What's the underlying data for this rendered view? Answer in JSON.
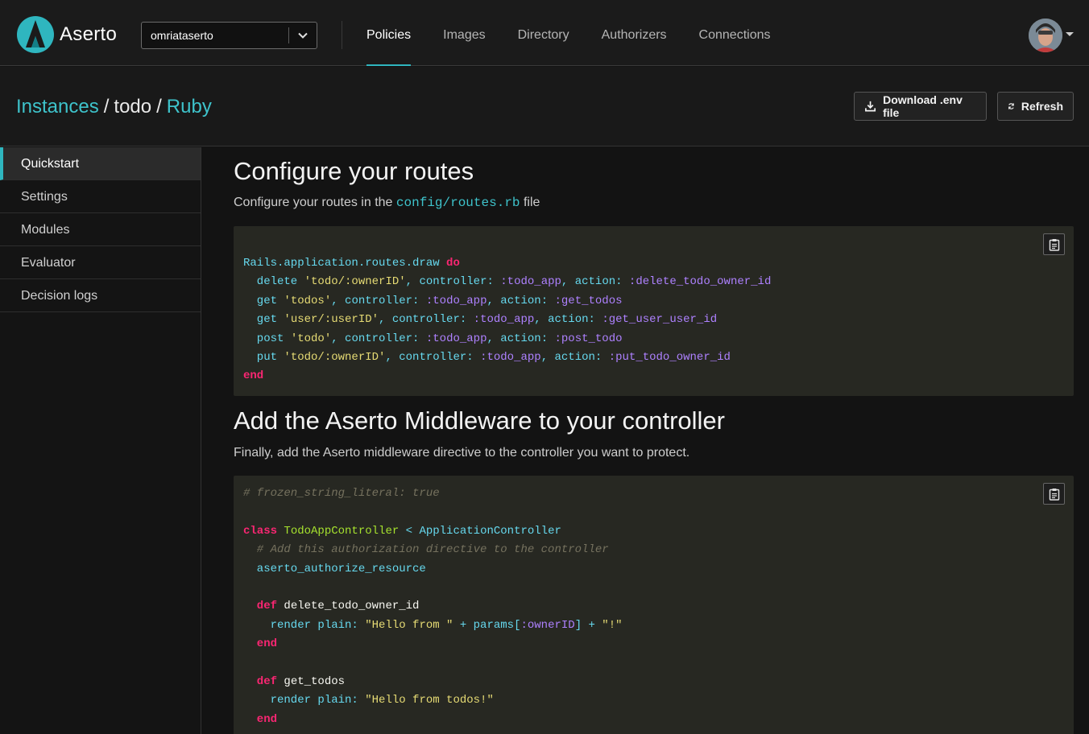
{
  "app": {
    "logo_text": "Aserto",
    "tenant": "omriataserto",
    "nav": [
      "Policies",
      "Images",
      "Directory",
      "Authorizers",
      "Connections"
    ],
    "active_nav": "Policies"
  },
  "header": {
    "crumbs": [
      "Instances",
      "todo",
      "Ruby"
    ],
    "download_label": "Download .env file",
    "refresh_label": "Refresh"
  },
  "sidebar": {
    "items": [
      "Quickstart",
      "Settings",
      "Modules",
      "Evaluator",
      "Decision logs"
    ],
    "active": "Quickstart"
  },
  "main": {
    "routes_title": "Configure your routes",
    "routes_desc_prefix": "Configure your routes in the ",
    "routes_desc_code": "config/routes.rb",
    "routes_desc_suffix": " file",
    "mw_title": "Add the Aserto Middleware to your controller",
    "mw_desc": "Finally, add the Aserto middleware directive to the controller you want to protect."
  },
  "code": {
    "routes": [
      [
        [
          "t",
          "Rails.application.routes.draw "
        ],
        [
          "k",
          "do"
        ]
      ],
      [
        [
          "t",
          "  delete "
        ],
        [
          "s",
          "'todo/:ownerID'"
        ],
        [
          "t",
          ", controller: "
        ],
        [
          "sym",
          ":todo_app"
        ],
        [
          "t",
          ", action: "
        ],
        [
          "sym",
          ":delete_todo_owner_id"
        ]
      ],
      [
        [
          "t",
          "  get "
        ],
        [
          "s",
          "'todos'"
        ],
        [
          "t",
          ", controller: "
        ],
        [
          "sym",
          ":todo_app"
        ],
        [
          "t",
          ", action: "
        ],
        [
          "sym",
          ":get_todos"
        ]
      ],
      [
        [
          "t",
          "  get "
        ],
        [
          "s",
          "'user/:userID'"
        ],
        [
          "t",
          ", controller: "
        ],
        [
          "sym",
          ":todo_app"
        ],
        [
          "t",
          ", action: "
        ],
        [
          "sym",
          ":get_user_user_id"
        ]
      ],
      [
        [
          "t",
          "  post "
        ],
        [
          "s",
          "'todo'"
        ],
        [
          "t",
          ", controller: "
        ],
        [
          "sym",
          ":todo_app"
        ],
        [
          "t",
          ", action: "
        ],
        [
          "sym",
          ":post_todo"
        ]
      ],
      [
        [
          "t",
          "  put "
        ],
        [
          "s",
          "'todo/:ownerID'"
        ],
        [
          "t",
          ", controller: "
        ],
        [
          "sym",
          ":todo_app"
        ],
        [
          "t",
          ", action: "
        ],
        [
          "sym",
          ":put_todo_owner_id"
        ]
      ],
      [
        [
          "k",
          "end"
        ]
      ]
    ],
    "middleware": [
      [
        [
          "c",
          "# frozen_string_literal: true"
        ]
      ],
      [],
      [
        [
          "k",
          "class "
        ],
        [
          "cn",
          "TodoAppController"
        ],
        [
          "t",
          " < ApplicationController"
        ]
      ],
      [
        [
          "c",
          "  # Add this authorization directive to the controller"
        ]
      ],
      [
        [
          "t",
          "  aserto_authorize_resource"
        ]
      ],
      [],
      [
        [
          "k",
          "  def "
        ],
        [
          "w",
          "delete_todo_owner_id"
        ]
      ],
      [
        [
          "t",
          "    render plain: "
        ],
        [
          "s",
          "\"Hello from \""
        ],
        [
          "t",
          " + params["
        ],
        [
          "sym",
          ":ownerID"
        ],
        [
          "t",
          "] + "
        ],
        [
          "s",
          "\"!\""
        ]
      ],
      [
        [
          "k",
          "  end"
        ]
      ],
      [],
      [
        [
          "k",
          "  def "
        ],
        [
          "w",
          "get_todos"
        ]
      ],
      [
        [
          "t",
          "    render plain: "
        ],
        [
          "s",
          "\"Hello from todos!\""
        ]
      ],
      [
        [
          "k",
          "  end"
        ]
      ]
    ]
  },
  "colors": {
    "accent": "#2fb6bf",
    "background": "#131313",
    "code_bg": "#272822"
  },
  "icons": [
    "aserto-logo",
    "chevron-down-icon",
    "download-icon",
    "refresh-icon",
    "clipboard-icon",
    "avatar"
  ]
}
